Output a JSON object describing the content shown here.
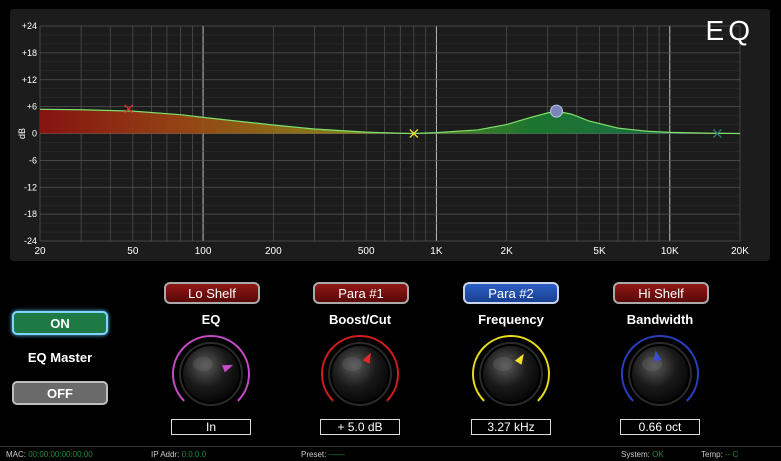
{
  "eq": {
    "title": "EQ",
    "y_axis_label": "dB",
    "y_ticks": [
      "+24",
      "+18",
      "+12",
      "+6",
      "0",
      "-6",
      "-12",
      "-18",
      "-24"
    ],
    "x_ticks": [
      "20",
      "50",
      "100",
      "200",
      "500",
      "1K",
      "2K",
      "5K",
      "10K",
      "20K"
    ]
  },
  "chart_data": {
    "type": "area",
    "x_scale": "log",
    "xlim": [
      20,
      20000
    ],
    "ylim": [
      -24,
      24
    ],
    "ylabel": "dB",
    "curve": {
      "x": [
        20,
        30,
        50,
        80,
        100,
        150,
        200,
        300,
        500,
        700,
        800,
        1000,
        1500,
        2000,
        2500,
        3000,
        3270,
        3800,
        4500,
        6000,
        8000,
        10000,
        15000,
        20000
      ],
      "y": [
        5.4,
        5.3,
        5.0,
        4.2,
        3.6,
        2.6,
        1.9,
        1.0,
        0.3,
        0.05,
        0,
        0.2,
        0.8,
        2.0,
        3.5,
        4.6,
        5.0,
        4.3,
        2.8,
        1.2,
        0.5,
        0.25,
        0.05,
        0
      ]
    },
    "handles": [
      {
        "name": "Lo Shelf",
        "x": 48,
        "y": 5.5,
        "marker": "x",
        "color": "#e03030"
      },
      {
        "name": "Para #1",
        "x": 800,
        "y": 0,
        "marker": "x",
        "color": "#f2e22a"
      },
      {
        "name": "Para #2",
        "x": 3270,
        "y": 5.0,
        "marker": "dot",
        "color": "#7a85b8"
      },
      {
        "name": "Hi Shelf",
        "x": 16000,
        "y": 0,
        "marker": "x",
        "color": "#2a7a72"
      }
    ]
  },
  "bands": [
    {
      "button": "Lo Shelf",
      "style": "red",
      "label": "EQ",
      "value": "In",
      "ring_color": "#c64bc8",
      "pointer_color": "#c64bc8",
      "knob_pos": 0.75
    },
    {
      "button": "Para #1",
      "style": "red",
      "label": "Boost/Cut",
      "value": "+ 5.0 dB",
      "ring_color": "#d21d1d",
      "pointer_color": "#e02a2a",
      "knob_pos": 0.6
    },
    {
      "button": "Para #2",
      "style": "blue",
      "label": "Frequency",
      "value": "3.27 kHz",
      "ring_color": "#e8dc16",
      "pointer_color": "#f2e22a",
      "knob_pos": 0.62
    },
    {
      "button": "Hi Shelf",
      "style": "red",
      "label": "Bandwidth",
      "value": "0.66 oct",
      "ring_color": "#2a3fc0",
      "pointer_color": "#3a4fd6",
      "knob_pos": 0.46
    }
  ],
  "master": {
    "on_label": "ON",
    "label": "EQ Master",
    "off_label": "OFF",
    "state": "on"
  },
  "status": {
    "mac_label": "MAC:",
    "mac_value": "00:00:00:00:00:00",
    "ip_label": "IP Addr:",
    "ip_value": "0.0.0.0",
    "preset_label": "Preset:",
    "preset_value": "——",
    "system_label": "System:",
    "system_value": "OK",
    "temp_label": "Temp:",
    "temp_value": "-- C"
  },
  "colors": {
    "accent_green": "#1e8c3a",
    "panel": "#1c1c1c"
  }
}
